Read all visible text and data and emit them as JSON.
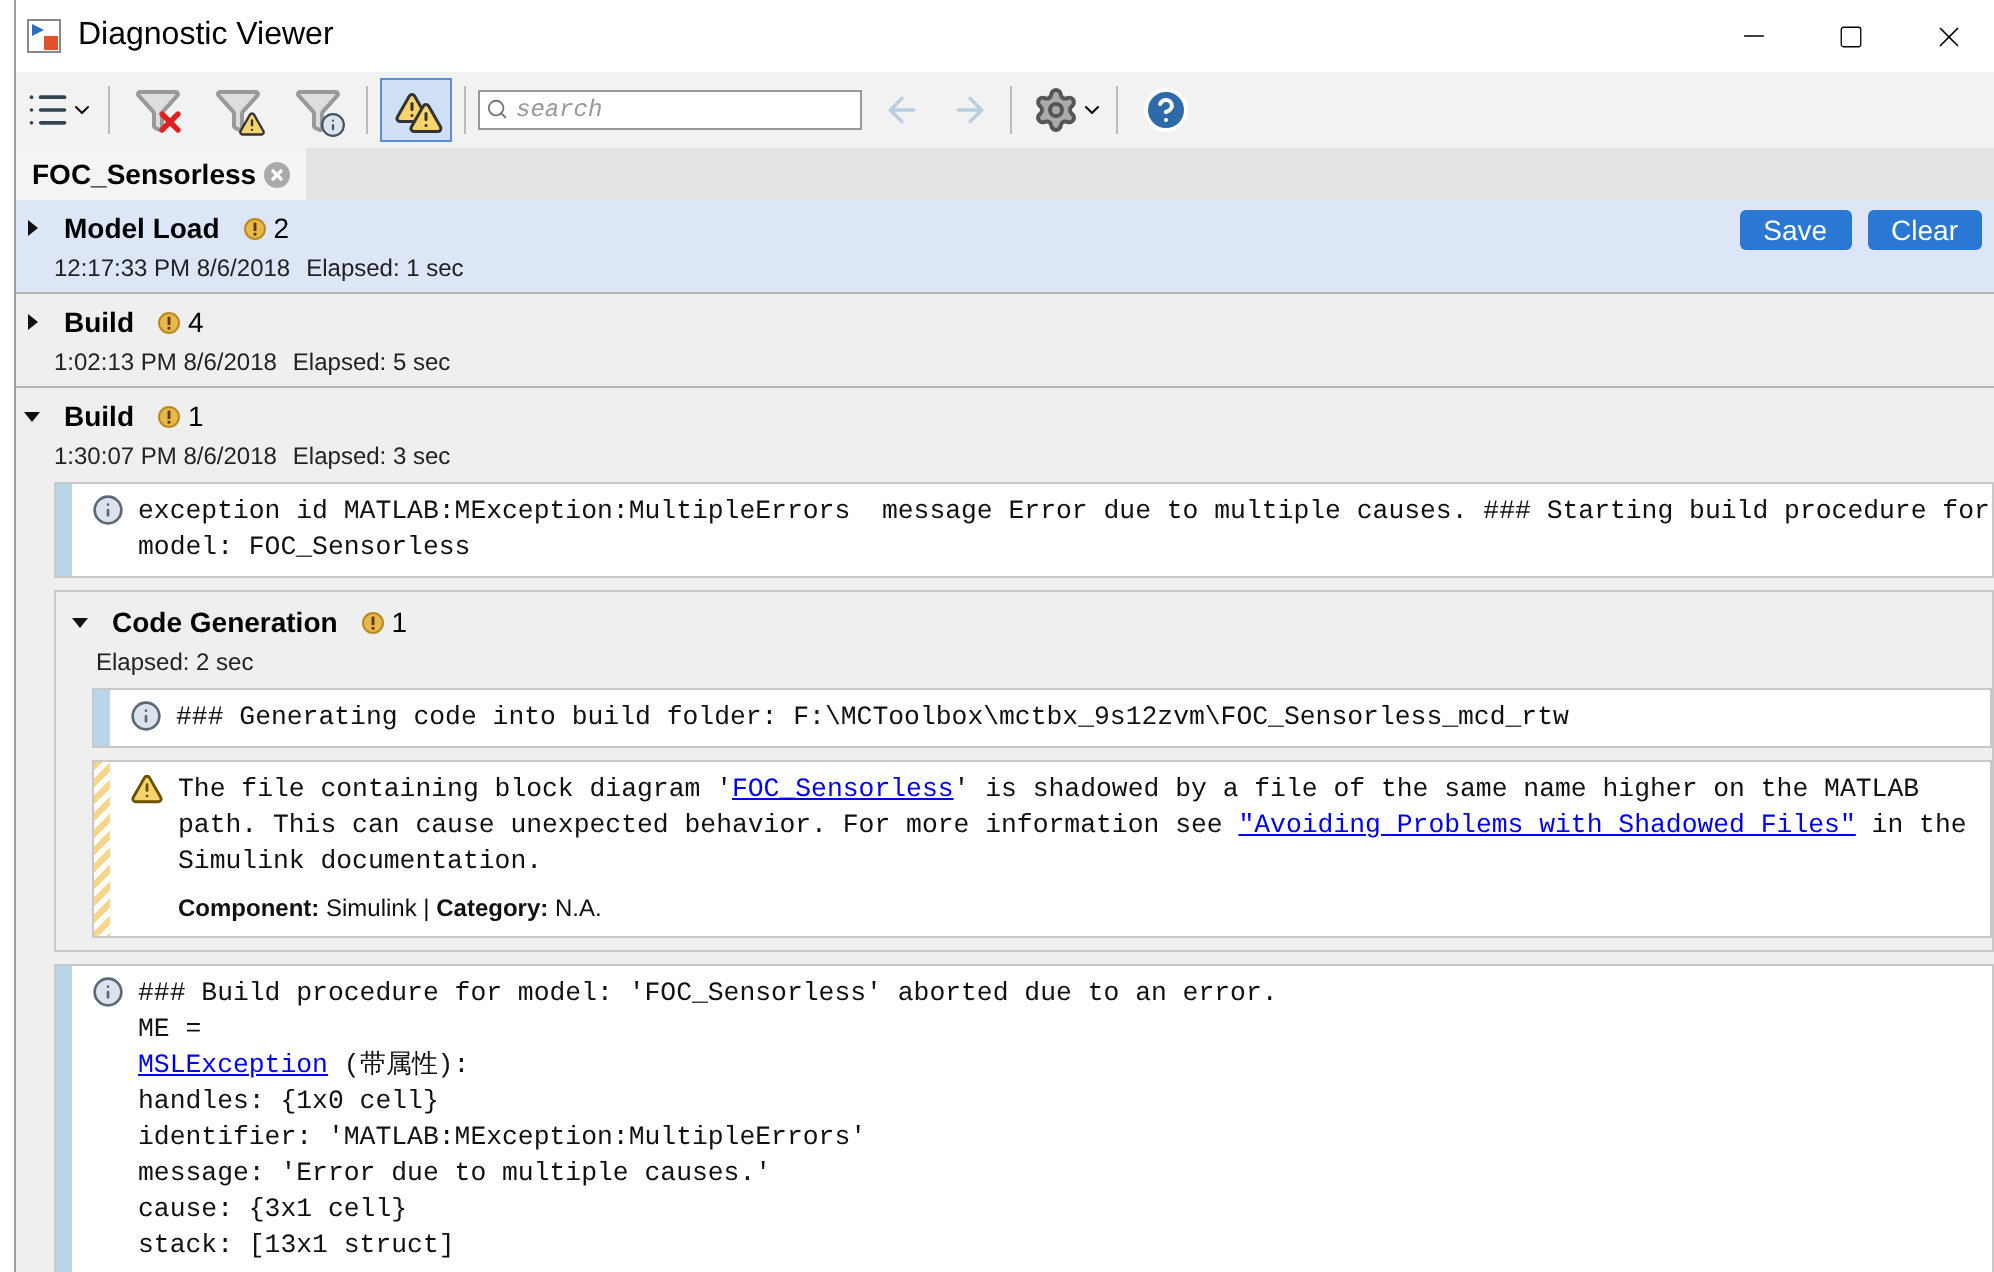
{
  "window": {
    "title": "Diagnostic Viewer"
  },
  "toolbar": {
    "search": {
      "placeholder": "search"
    },
    "highlight_warnings": {
      "on": true
    }
  },
  "tabs": [
    {
      "label": "FOC_Sensorless",
      "selected": true
    }
  ],
  "actions": [
    "Save",
    "Clear"
  ],
  "stages": [
    {
      "name": "Model Load",
      "count": "2",
      "time": "12:17:33 PM 8/6/2018",
      "elapsed": "Elapsed: 1 sec",
      "expanded": false,
      "selected": true
    },
    {
      "name": "Build",
      "count": "4",
      "time": "1:02:13 PM 8/6/2018",
      "elapsed": "Elapsed: 5 sec",
      "expanded": false,
      "selected": false
    },
    {
      "name": "Build",
      "count": "1",
      "time": "1:30:07 PM 8/6/2018",
      "elapsed": "Elapsed: 3 sec",
      "expanded": true,
      "selected": false,
      "items": [
        {
          "kind": "info",
          "lines": [
            [
              {
                "text": "exception id MATLAB:MException:MultipleErrors  message Error due to multiple causes. ### Starting build procedure for model: FOC_Sensorless"
              }
            ]
          ]
        },
        {
          "kind": "stage",
          "name": "Code Generation",
          "count": "1",
          "elapsed": "Elapsed: 2 sec",
          "expanded": true,
          "selected": false,
          "items": [
            {
              "kind": "info",
              "lines": [
                [
                  {
                    "text": "### Generating code into build folder: F:\\MCToolbox\\mctbx_9s12zvm\\FOC_Sensorless_mcd_rtw"
                  }
                ]
              ]
            },
            {
              "kind": "warning",
              "lines": [
                [
                  {
                    "text": "The file containing block diagram '"
                  },
                  {
                    "text": "FOC_Sensorless",
                    "link": true
                  },
                  {
                    "text": "' is shadowed by a file of the same name higher on the MATLAB path. This can cause unexpected behavior. For more information see "
                  },
                  {
                    "text": "\"Avoiding Problems with Shadowed Files\"",
                    "link": true
                  },
                  {
                    "text": " in the Simulink documentation."
                  }
                ]
              ],
              "footer": "**Component:** Simulink | **Category:** N.A."
            }
          ]
        },
        {
          "kind": "info",
          "lines": [
            [
              {
                "text": "### Build procedure for model: 'FOC_Sensorless' aborted due to an error."
              }
            ],
            [
              {
                "text": "ME ="
              }
            ],
            [
              {
                "text": "MSLException",
                "link": true
              },
              {
                "text": " (带属性):"
              }
            ],
            [
              {
                "text": "handles: {1x0 cell}"
              }
            ],
            [
              {
                "text": "identifier: 'MATLAB:MException:MultipleErrors'"
              }
            ],
            [
              {
                "text": "message: 'Error due to multiple causes.'"
              }
            ],
            [
              {
                "text": "cause: {3x1 cell}"
              }
            ],
            [
              {
                "text": "stack: [13x1 struct]"
              }
            ]
          ]
        }
      ]
    }
  ]
}
